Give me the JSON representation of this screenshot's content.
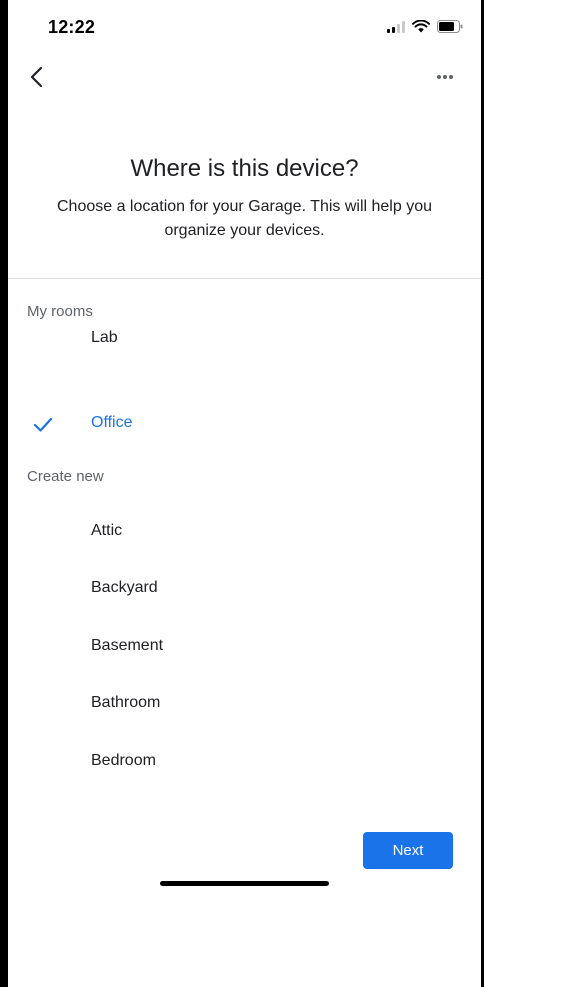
{
  "status_bar": {
    "time": "12:22"
  },
  "header": {
    "title": "Where is this device?",
    "subtitle": "Choose a location for your Garage. This will help you organize your devices."
  },
  "sections": {
    "my_rooms": {
      "label": "My rooms",
      "items": [
        {
          "label": "Lab",
          "selected": false
        },
        {
          "label": "Office",
          "selected": true
        }
      ]
    },
    "create_new": {
      "label": "Create new",
      "items": [
        {
          "label": "Attic"
        },
        {
          "label": "Backyard"
        },
        {
          "label": "Basement"
        },
        {
          "label": "Bathroom"
        },
        {
          "label": "Bedroom"
        }
      ]
    }
  },
  "footer": {
    "next_label": "Next"
  },
  "colors": {
    "accent": "#1a73e8",
    "divider": "#dadce0",
    "secondary_text": "#5f6368"
  },
  "icons": {
    "back": "chevron-left-icon",
    "more": "more-horiz-icon",
    "check": "checkmark-icon"
  }
}
